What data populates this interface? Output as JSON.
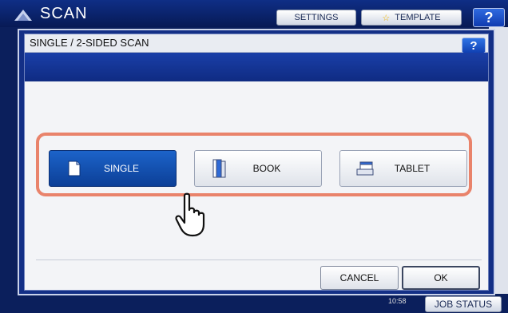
{
  "background_app": {
    "title": "SCAN",
    "settings_label": "SETTINGS",
    "template_label": "TEMPLATE",
    "help_label": "?",
    "clock_line2": "10:58",
    "job_status_label": "JOB STATUS"
  },
  "dialog": {
    "title": "SINGLE / 2-SIDED SCAN",
    "help_label": "?",
    "options": [
      {
        "label": "SINGLE",
        "icon": "single-page-icon",
        "selected": true
      },
      {
        "label": "BOOK",
        "icon": "book-icon",
        "selected": false
      },
      {
        "label": "TABLET",
        "icon": "tablet-icon",
        "selected": false
      }
    ],
    "cancel_label": "CANCEL",
    "ok_label": "OK"
  },
  "colors": {
    "selected": "#1c63c9",
    "highlight_frame": "#e9836b",
    "chrome": "#132f86"
  }
}
